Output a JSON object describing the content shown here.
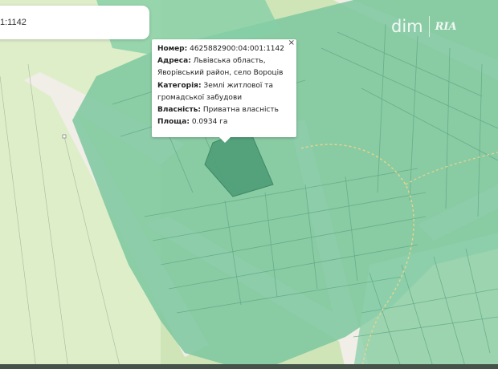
{
  "search": {
    "value": "1:1142"
  },
  "popup": {
    "close_symbol": "×",
    "number_label": "Номер:",
    "number_value": "4625882900:04:001:1142",
    "address_label": "Адреса:",
    "address_value_line1": "Львівська область,",
    "address_value_line2": "Яворівський район, село Вороців",
    "category_label": "Категорія:",
    "category_value_line1": "Землі житлової та",
    "category_value_line2": "громадської забудови",
    "ownership_label": "Власність:",
    "ownership_value": "Приватна власність",
    "area_label": "Площа:",
    "area_value": "0.0934 га"
  },
  "watermark": {
    "brand_left": "dim",
    "brand_right": "RIA"
  },
  "colors": {
    "base_green": "#d6e8c4",
    "parcel_green": "#7ecba0",
    "parcel_dark": "#5aa883",
    "selected_parcel": "#4f9d78",
    "road": "#f2efe9",
    "track_dashed": "#e5d38a"
  }
}
